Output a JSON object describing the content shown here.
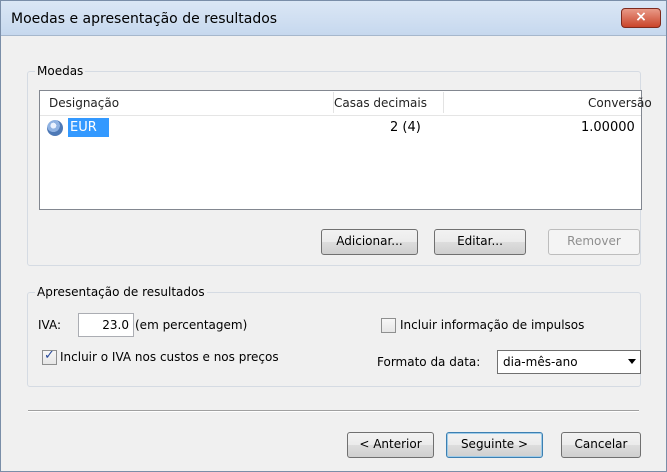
{
  "window": {
    "title": "Moedas e apresentação de resultados",
    "close_label": "×"
  },
  "moedas": {
    "legend": "Moedas",
    "columns": [
      "Designação",
      "Casas decimais",
      "Conversão"
    ],
    "rows": [
      {
        "designacao": "EUR",
        "casas": "2  (4)",
        "conversao": "1.00000",
        "icon": "coin-icon"
      }
    ],
    "buttons": {
      "add": "Adicionar...",
      "edit": "Editar...",
      "remove": "Remover"
    }
  },
  "apresentacao": {
    "legend": "Apresentação de resultados",
    "iva_label": "IVA:",
    "iva_value": "23.0",
    "iva_unit": "(em percentagem)",
    "include_iva_label": "Incluir o IVA nos custos e nos preços",
    "include_iva_checked": true,
    "impulsos_label": "Incluir informação de impulsos",
    "impulsos_checked": false,
    "date_format_label": "Formato da data:",
    "date_format_value": "dia-mês-ano"
  },
  "footer": {
    "back": "< Anterior",
    "next": "Seguinte >",
    "cancel": "Cancelar"
  }
}
